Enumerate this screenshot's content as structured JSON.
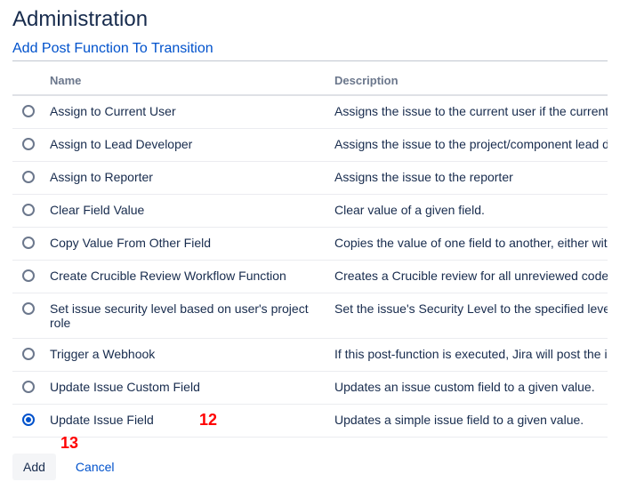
{
  "page_title": "Administration",
  "section_title": "Add Post Function To Transition",
  "columns": {
    "name": "Name",
    "description": "Description"
  },
  "rows": [
    {
      "name": "Assign to Current User",
      "desc": "Assigns the issue to the current user if the current user",
      "selected": false
    },
    {
      "name": "Assign to Lead Developer",
      "desc": "Assigns the issue to the project/component lead devel",
      "selected": false
    },
    {
      "name": "Assign to Reporter",
      "desc": "Assigns the issue to the reporter",
      "selected": false
    },
    {
      "name": "Clear Field Value",
      "desc": "Clear value of a given field.",
      "selected": false
    },
    {
      "name": "Copy Value From Other Field",
      "desc": "Copies the value of one field to another, either within th",
      "selected": false
    },
    {
      "name": "Create Crucible Review Workflow Function",
      "desc": "Creates a Crucible review for all unreviewed code for th",
      "selected": false
    },
    {
      "name": "Set issue security level based on user's project role",
      "desc": "Set the issue's Security Level to the specified level if th",
      "selected": false
    },
    {
      "name": "Trigger a Webhook",
      "desc": "If this post-function is executed, Jira will post the issue",
      "selected": false
    },
    {
      "name": "Update Issue Custom Field",
      "desc": "Updates an issue custom field to a given value.",
      "selected": false
    },
    {
      "name": "Update Issue Field",
      "desc": "Updates a simple issue field to a given value.",
      "selected": true,
      "annotation": "12"
    }
  ],
  "buttons": {
    "add": "Add",
    "cancel": "Cancel"
  },
  "annotations": {
    "add_button": "13"
  }
}
